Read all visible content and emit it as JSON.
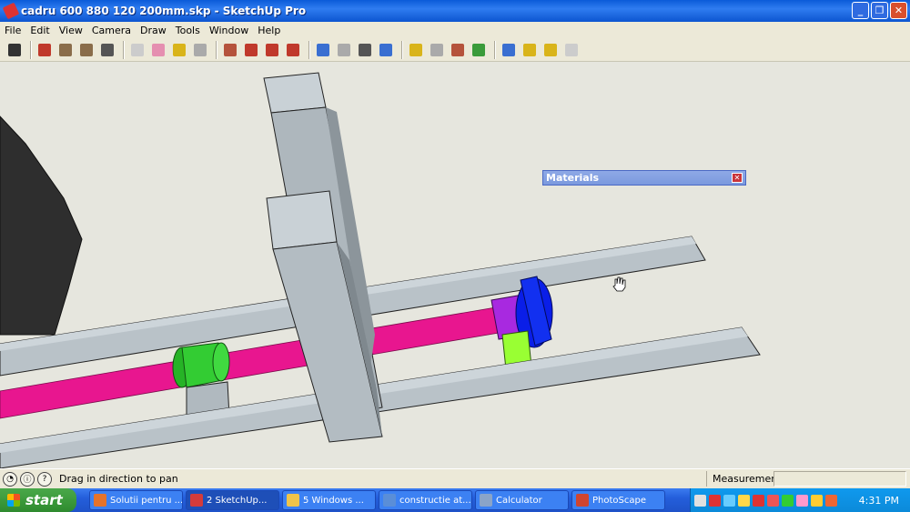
{
  "window": {
    "title": "cadru 600 880 120 200mm.skp - SketchUp Pro",
    "minimize_glyph": "_",
    "restore_glyph": "❐",
    "close_glyph": "✕"
  },
  "menu": [
    "File",
    "Edit",
    "View",
    "Camera",
    "Draw",
    "Tools",
    "Window",
    "Help"
  ],
  "toolbar": {
    "tools": [
      {
        "icon": "select-arrow-icon",
        "color": "#333333"
      },
      {
        "icon": "line-pencil-icon",
        "color": "#c0392b"
      },
      {
        "icon": "rectangle-icon",
        "color": "#8a6d4a"
      },
      {
        "icon": "circle-icon",
        "color": "#8a6d4a"
      },
      {
        "icon": "arc-icon",
        "color": "#555555"
      },
      {
        "icon": "make-component-icon",
        "color": "#cccccc"
      },
      {
        "icon": "eraser-icon",
        "color": "#e58fb0"
      },
      {
        "icon": "tape-measure-icon",
        "color": "#d9b41a"
      },
      {
        "icon": "paint-bucket-icon",
        "color": "#aaaaaa"
      },
      {
        "icon": "push-pull-icon",
        "color": "#b5533c"
      },
      {
        "icon": "move-icon",
        "color": "#c0392b"
      },
      {
        "icon": "rotate-icon",
        "color": "#c0392b"
      },
      {
        "icon": "offset-icon",
        "color": "#c0392b"
      },
      {
        "icon": "orbit-icon",
        "color": "#3a6fd1"
      },
      {
        "icon": "pan-hand-icon",
        "color": "#aaaaaa"
      },
      {
        "icon": "zoom-icon",
        "color": "#555555"
      },
      {
        "icon": "zoom-extents-icon",
        "color": "#3a6fd1"
      },
      {
        "icon": "previous-view-icon",
        "color": "#d9b41a"
      },
      {
        "icon": "next-view-icon",
        "color": "#aaaaaa"
      },
      {
        "icon": "position-camera-icon",
        "color": "#b5533c"
      },
      {
        "icon": "walk-icon",
        "color": "#3a9b3a"
      },
      {
        "icon": "get-models-icon",
        "color": "#3a6fd1"
      },
      {
        "icon": "share-model-icon",
        "color": "#d9b41a"
      },
      {
        "icon": "component-share-icon",
        "color": "#d9b41a"
      },
      {
        "icon": "extension-warehouse-icon",
        "color": "#cccccc"
      }
    ]
  },
  "materials_panel": {
    "title": "Materials"
  },
  "status": {
    "hint": "Drag in direction to pan",
    "measurements_label": "Measurements",
    "measurements_value": ""
  },
  "taskbar": {
    "start_label": "start",
    "tasks": [
      {
        "label": "Solutii pentru ...",
        "color": "#e5732b"
      },
      {
        "label": "2 SketchUp...",
        "color": "#d33b3b"
      },
      {
        "label": "5 Windows ...",
        "color": "#f0c44a"
      },
      {
        "label": "constructie at...",
        "color": "#5a8ed8"
      },
      {
        "label": "Calculator",
        "color": "#8aa4c8"
      },
      {
        "label": "PhotoScape",
        "color": "#d0452f"
      }
    ],
    "clock": "4:31 PM"
  }
}
